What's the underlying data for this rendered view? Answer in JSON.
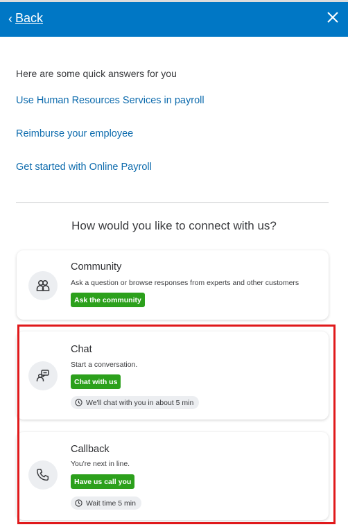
{
  "header": {
    "back_label": "Back",
    "chevron_glyph": "‹",
    "accent_color": "#0077c5",
    "close_icon": "close-icon"
  },
  "quick_answers": {
    "intro": "Here are some quick answers for you",
    "links": [
      "Use Human Resources Services in payroll",
      "Reimburse your employee",
      "Get started with Online Payroll"
    ]
  },
  "connect": {
    "title": "How would you like to connect with us?",
    "options": [
      {
        "icon": "community-icon",
        "title": "Community",
        "description": "Ask a question or browse responses from experts and other customers",
        "button": "Ask the community"
      },
      {
        "icon": "chat-icon",
        "title": "Chat",
        "description": "Start a conversation.",
        "button": "Chat with us",
        "wait": "We'll chat with you in about 5 min"
      },
      {
        "icon": "phone-icon",
        "title": "Callback",
        "description": "You're next in line.",
        "button": "Have us call you",
        "wait": "Wait time 5 min"
      }
    ]
  },
  "colors": {
    "action_green": "#2ca01c",
    "link_blue": "#0d6bad",
    "highlight_red": "#e0191b"
  }
}
